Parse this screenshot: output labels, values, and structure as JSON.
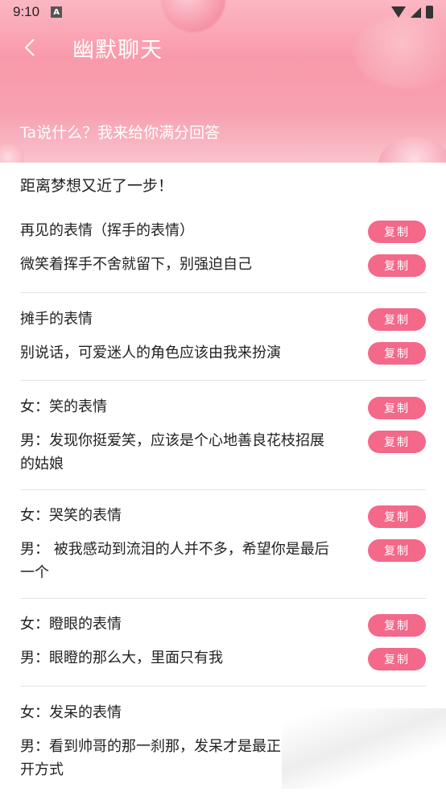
{
  "status_bar": {
    "time": "9:10",
    "a_badge": "A",
    "icons": [
      "wifi-icon",
      "signal-icon",
      "battery-icon"
    ]
  },
  "header": {
    "title": "幽默聊天",
    "subtitle": "Ta说什么？我来给你满分回答",
    "back_icon": "chevron-left-icon"
  },
  "intro": "距离梦想又近了一步！",
  "copy_label": "复制",
  "colors": {
    "accent": "#f4688a",
    "header_bg": "#f99aab"
  },
  "groups": [
    {
      "lines": [
        "再见的表情（挥手的表情）",
        "微笑着挥手不舍就留下，别强迫自己"
      ]
    },
    {
      "lines": [
        "摊手的表情",
        "别说话，可爱迷人的角色应该由我来扮演"
      ]
    },
    {
      "lines": [
        "女：笑的表情",
        "男：发现你挺爱笑，应该是个心地善良花枝招展",
        "的姑娘"
      ]
    },
    {
      "lines": [
        "女：哭笑的表情",
        "男： 被我感动到流泪的人并不多，希望你是最后",
        "一个"
      ]
    },
    {
      "lines": [
        "女：瞪眼的表情",
        "男：眼瞪的那么大，里面只有我"
      ]
    },
    {
      "lines": [
        "女：发呆的表情",
        "男：看到帅哥的那一刹那，发呆才是最正",
        "开方式"
      ]
    }
  ]
}
